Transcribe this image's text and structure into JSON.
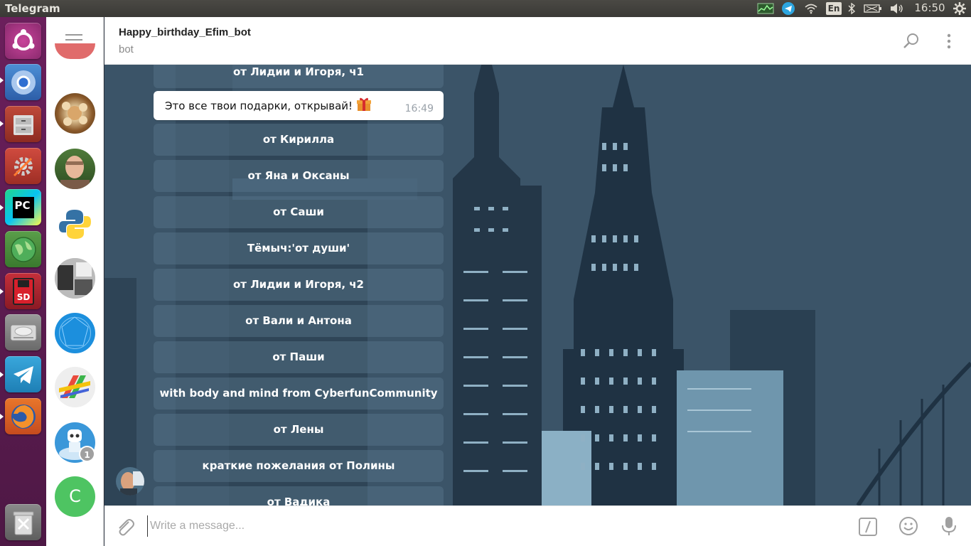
{
  "panel": {
    "app_title": "Telegram",
    "keyboard_layout": "En",
    "clock": "16:50"
  },
  "launcher": {
    "apps": [
      {
        "name": "ubuntu-dash",
        "icon": "ubuntu-logo-icon"
      },
      {
        "name": "chromium",
        "icon": "chromium-icon"
      },
      {
        "name": "files",
        "icon": "file-cabinet-icon"
      },
      {
        "name": "system-settings",
        "icon": "settings-tools-icon"
      },
      {
        "name": "pycharm",
        "icon": "pycharm-icon",
        "label": "PC"
      },
      {
        "name": "globe-app",
        "icon": "globe-icon"
      },
      {
        "name": "sd-app",
        "icon": "sd-floppy-icon",
        "label": "SD"
      },
      {
        "name": "disk",
        "icon": "hard-disk-icon"
      },
      {
        "name": "telegram",
        "icon": "telegram-icon"
      },
      {
        "name": "firefox",
        "icon": "firefox-icon"
      },
      {
        "name": "trash",
        "icon": "trash-icon"
      }
    ]
  },
  "chatlist": {
    "unread_badge": "1",
    "contact_initial": "C"
  },
  "header": {
    "title": "Happy_birthday_Efim_bot",
    "status": "bot"
  },
  "chat": {
    "keyboard_buttons_top": [
      "от Лидии и Игоря, ч1"
    ],
    "message": {
      "text": "Это все твои подарки, открывай!",
      "time": "16:49"
    },
    "keyboard_buttons": [
      "от Кирилла",
      "от Яна и Оксаны",
      "от Саши",
      "Тёмыч:'от души'",
      "от Лидии и Игоря, ч2",
      "от Вали и Антона",
      "от Паши",
      "with body and mind from CyberfunCommunity",
      "от Лены",
      "краткие пожелания от Полины",
      "от Вадика"
    ]
  },
  "composer": {
    "placeholder": "Write a message..."
  }
}
